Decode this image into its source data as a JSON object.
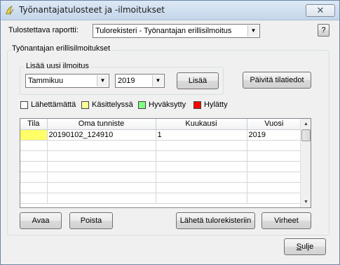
{
  "window": {
    "title": "Työnantajatulosteet ja -ilmoitukset",
    "close_glyph": "✕"
  },
  "report": {
    "label": "Tulostettava raportti:",
    "selected": "Tulorekisteri - Työnantajan erillisilmoitus",
    "help_label": "?"
  },
  "section": {
    "title": "Työnantajan erillisilmoitukset",
    "new_notice": {
      "title": "Lisää uusi ilmoitus",
      "month": "Tammikuu",
      "year": "2019",
      "add_label": "Lisää"
    },
    "refresh_label": "Päivitä tilatiedot"
  },
  "legend": [
    {
      "label": "Lähettämättä",
      "color": "#ffffff"
    },
    {
      "label": "Käsittelyssä",
      "color": "#ffff99"
    },
    {
      "label": "Hyväksytty",
      "color": "#80ff80"
    },
    {
      "label": "Hylätty",
      "color": "#ff0000"
    }
  ],
  "table": {
    "columns": [
      "Tila",
      "Oma tunniste",
      "Kuukausi",
      "Vuosi"
    ],
    "rows": [
      {
        "tila": "",
        "tunniste": "20190102_124910",
        "kuukausi": "1",
        "vuosi": "2019",
        "status_color": "#ffff66"
      }
    ]
  },
  "buttons": {
    "open": "Avaa",
    "delete": "Poista",
    "send": "Lähetä tulorekisteriin",
    "errors": "Virheet",
    "close": "Sulje",
    "close_mnemonic": "S",
    "close_rest": "ulje"
  },
  "colors": {
    "selected_status": "#ffff66",
    "accent": "#3c7fb1"
  }
}
